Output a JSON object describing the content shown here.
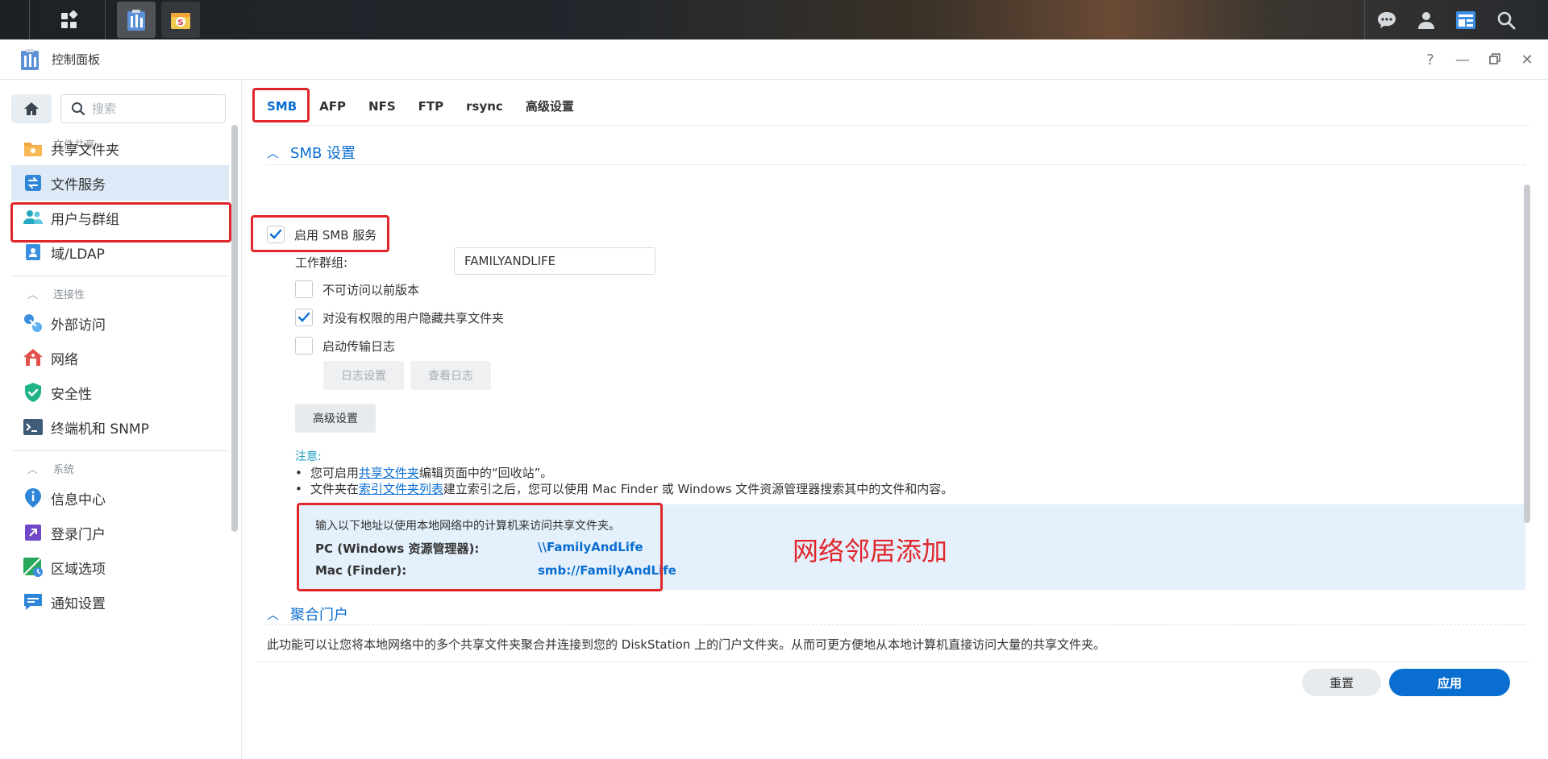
{
  "window": {
    "title": "控制面板",
    "help_icon": "question-mark",
    "minimize_icon": "minimize",
    "restore_icon": "restore",
    "close_icon": "close"
  },
  "sidebar": {
    "search_placeholder": "搜索",
    "sections": [
      {
        "title": "文件共享",
        "items": [
          "共享文件夹",
          "文件服务",
          "用户与群组",
          "域/LDAP"
        ]
      },
      {
        "title": "连接性",
        "items": [
          "外部访问",
          "网络",
          "安全性",
          "终端机和 SNMP"
        ]
      },
      {
        "title": "系统",
        "items": [
          "信息中心",
          "登录门户",
          "区域选项",
          "通知设置"
        ]
      }
    ],
    "active_item": "文件服务"
  },
  "tabs": [
    "SMB",
    "AFP",
    "NFS",
    "FTP",
    "rsync",
    "高级设置"
  ],
  "active_tab": "SMB",
  "smb": {
    "section_title": "SMB 设置",
    "enable_label": "启用 SMB 服务",
    "enable_checked": true,
    "workgroup_label": "工作群组:",
    "workgroup_value": "FAMILYANDLIFE",
    "prev_versions_label": "不可访问以前版本",
    "prev_versions_checked": false,
    "hide_shares_label": "对没有权限的用户隐藏共享文件夹",
    "hide_shares_checked": true,
    "transfer_log_label": "启动传输日志",
    "transfer_log_checked": false,
    "log_settings_button": "日志设置",
    "view_log_button": "查看日志",
    "advanced_button": "高级设置"
  },
  "notes": {
    "title": "注意:",
    "item1_prefix": "您可启用 ",
    "item1_link": "共享文件夹",
    "item1_suffix": " 编辑页面中的“回收站”。",
    "item2_prefix": "文件夹在 ",
    "item2_link": "索引文件夹列表",
    "item2_suffix": "建立索引之后，您可以使用 Mac Finder 或 Windows 文件资源管理器搜索其中的文件和内容。"
  },
  "address": {
    "intro": "输入以下地址以使用本地网络中的计算机来访问共享文件夹。",
    "pc_label": "PC (Windows 资源管理器):",
    "pc_value": "\\\\FamilyAndLife",
    "mac_label": "Mac (Finder):",
    "mac_value": "smb://FamilyAndLife"
  },
  "annotation": "网络邻居添加",
  "aggregation": {
    "section_title": "聚合门户",
    "description": "此功能可以让您将本地网络中的多个共享文件夹聚合并连接到您的 DiskStation 上的门户文件夹。从而可更方便地从本地计算机直接访问大量的共享文件夹。"
  },
  "footer": {
    "reset_button": "重置",
    "apply_button": "应用"
  },
  "colors": {
    "accent": "#0a6ed1",
    "highlight_box": "#e0262b",
    "active_sidebar_bg": "#dde9f6",
    "address_panel_bg": "#e4f0fb"
  }
}
